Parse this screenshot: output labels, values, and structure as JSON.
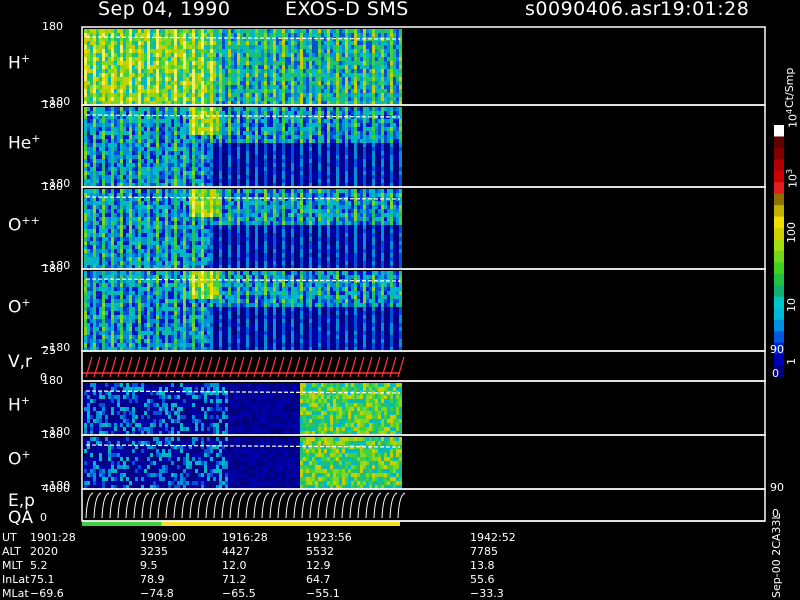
{
  "header": {
    "date": "Sep 04, 1990",
    "mission": "EXOS-D SMS",
    "file": "s0090406.asr",
    "time": "19:01:28"
  },
  "colors": {
    "background": "#000000",
    "frame": "#ffffff",
    "velocity_trace": "#ff3030",
    "qa_good": "#40d040",
    "qa_warn": "#f0e020"
  },
  "colorbar": {
    "unit_label": "Ct/Smp",
    "ticks": [
      "1",
      "10",
      "100",
      "10",
      "10"
    ],
    "tick_exps": [
      "",
      "",
      "",
      "3",
      "4"
    ],
    "colors": [
      "#00007f",
      "#0000b4",
      "#0020d0",
      "#0058e0",
      "#0090e0",
      "#00b8d8",
      "#00c8c8",
      "#10b070",
      "#20c040",
      "#40d020",
      "#70d818",
      "#a0e010",
      "#d0d000",
      "#f0e000",
      "#c0b000",
      "#907000",
      "#e02020",
      "#d00000",
      "#b00000",
      "#800000",
      "#600000",
      "#ffffff"
    ]
  },
  "side_label": "Sep-00 2CA33L",
  "panels": [
    {
      "id": "h-plus",
      "label": "H",
      "sup": "+",
      "top": "180",
      "bottom": "−180",
      "right_top": "",
      "right_bottom": ""
    },
    {
      "id": "he-plus",
      "label": "He",
      "sup": "+",
      "top": "180",
      "bottom": "−180",
      "right_top": "",
      "right_bottom": ""
    },
    {
      "id": "o-plus-plus",
      "label": "O",
      "sup": "++",
      "top": "180",
      "bottom": "−180",
      "right_top": "",
      "right_bottom": ""
    },
    {
      "id": "o-plus",
      "label": "O",
      "sup": "+",
      "top": "180",
      "bottom": "−180",
      "right_top": "",
      "right_bottom": ""
    },
    {
      "id": "vr",
      "label": "V,r",
      "sup": "",
      "top": "25",
      "bottom": "0",
      "right_top": "90",
      "right_bottom": "0"
    },
    {
      "id": "h-plus-2",
      "label": "H",
      "sup": "+",
      "top": "180",
      "bottom": "−180",
      "right_top": "",
      "right_bottom": ""
    },
    {
      "id": "o-plus-2",
      "label": "O",
      "sup": "+",
      "top": "180",
      "bottom": "−180",
      "right_top": "",
      "right_bottom": ""
    },
    {
      "id": "ep",
      "label": "E,p",
      "sup": "",
      "top": "4000",
      "bottom": "0",
      "right_top": "90",
      "right_bottom": "0"
    }
  ],
  "qa_label": "QA",
  "qa_segments": [
    {
      "from": 0.0,
      "to": 0.25,
      "status": "good"
    },
    {
      "from": 0.25,
      "to": 1.0,
      "status": "warn"
    }
  ],
  "ephemeris": {
    "labels": [
      "UT",
      "ALT",
      "MLT",
      "InLat",
      "MLat"
    ],
    "columns": [
      [
        "1901:28",
        "2020",
        "5.2",
        "75.1",
        "−69.6"
      ],
      [
        "1909:00",
        "3235",
        "9.5",
        "78.9",
        "−74.8"
      ],
      [
        "1916:28",
        "4427",
        "12.0",
        "71.2",
        "−65.5"
      ],
      [
        "1923:56",
        "5532",
        "12.9",
        "64.7",
        "−55.1"
      ],
      [
        "1942:52",
        "7785",
        "13.8",
        "55.6",
        "−33.3"
      ]
    ]
  },
  "chart_data": {
    "type": "heatmap",
    "x_ticks_ut": [
      "1901:28",
      "1909:00",
      "1916:28",
      "1923:56",
      "1942:52"
    ],
    "colorbar_scale": "log",
    "colorbar_range": [
      1,
      10000
    ],
    "data_coverage_end_ut": "1926:00",
    "panels": [
      "H+",
      "He+",
      "O++",
      "O+",
      "V,r",
      "H+",
      "O+",
      "E,p"
    ]
  }
}
